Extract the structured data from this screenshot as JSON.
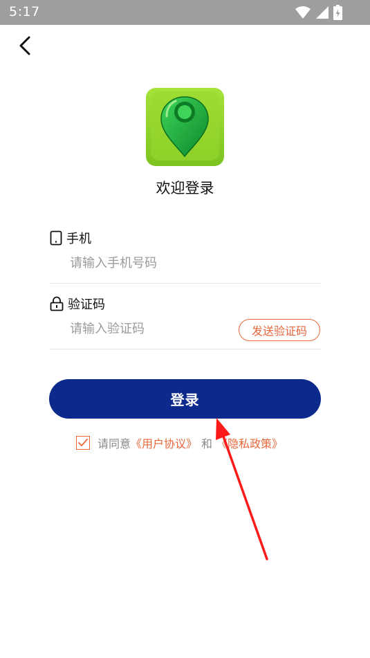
{
  "status_bar": {
    "time": "5:17",
    "icons": [
      "wifi-icon",
      "signal-icon",
      "battery-icon"
    ]
  },
  "header": {
    "back_icon": "chevron-left-icon"
  },
  "app": {
    "logo_icon": "map-pin-icon",
    "welcome_title": "欢迎登录"
  },
  "form": {
    "phone": {
      "label": "手机",
      "icon": "phone-icon",
      "placeholder": "请输入手机号码",
      "value": ""
    },
    "code": {
      "label": "验证码",
      "icon": "lock-icon",
      "placeholder": "请输入验证码",
      "value": "",
      "send_button_label": "发送验证码"
    }
  },
  "login_button_label": "登录",
  "agreement": {
    "checked": true,
    "prefix": "请同意",
    "user_agreement_link": "《用户协议》",
    "and_text": "和",
    "privacy_policy_link": "《隐私政策》"
  },
  "colors": {
    "primary": "#0c2a8c",
    "accent": "#e8673a",
    "status_bar": "#9e9e9e",
    "logo_green": "#8fd42a",
    "annotation_red": "#ff1a1a"
  }
}
